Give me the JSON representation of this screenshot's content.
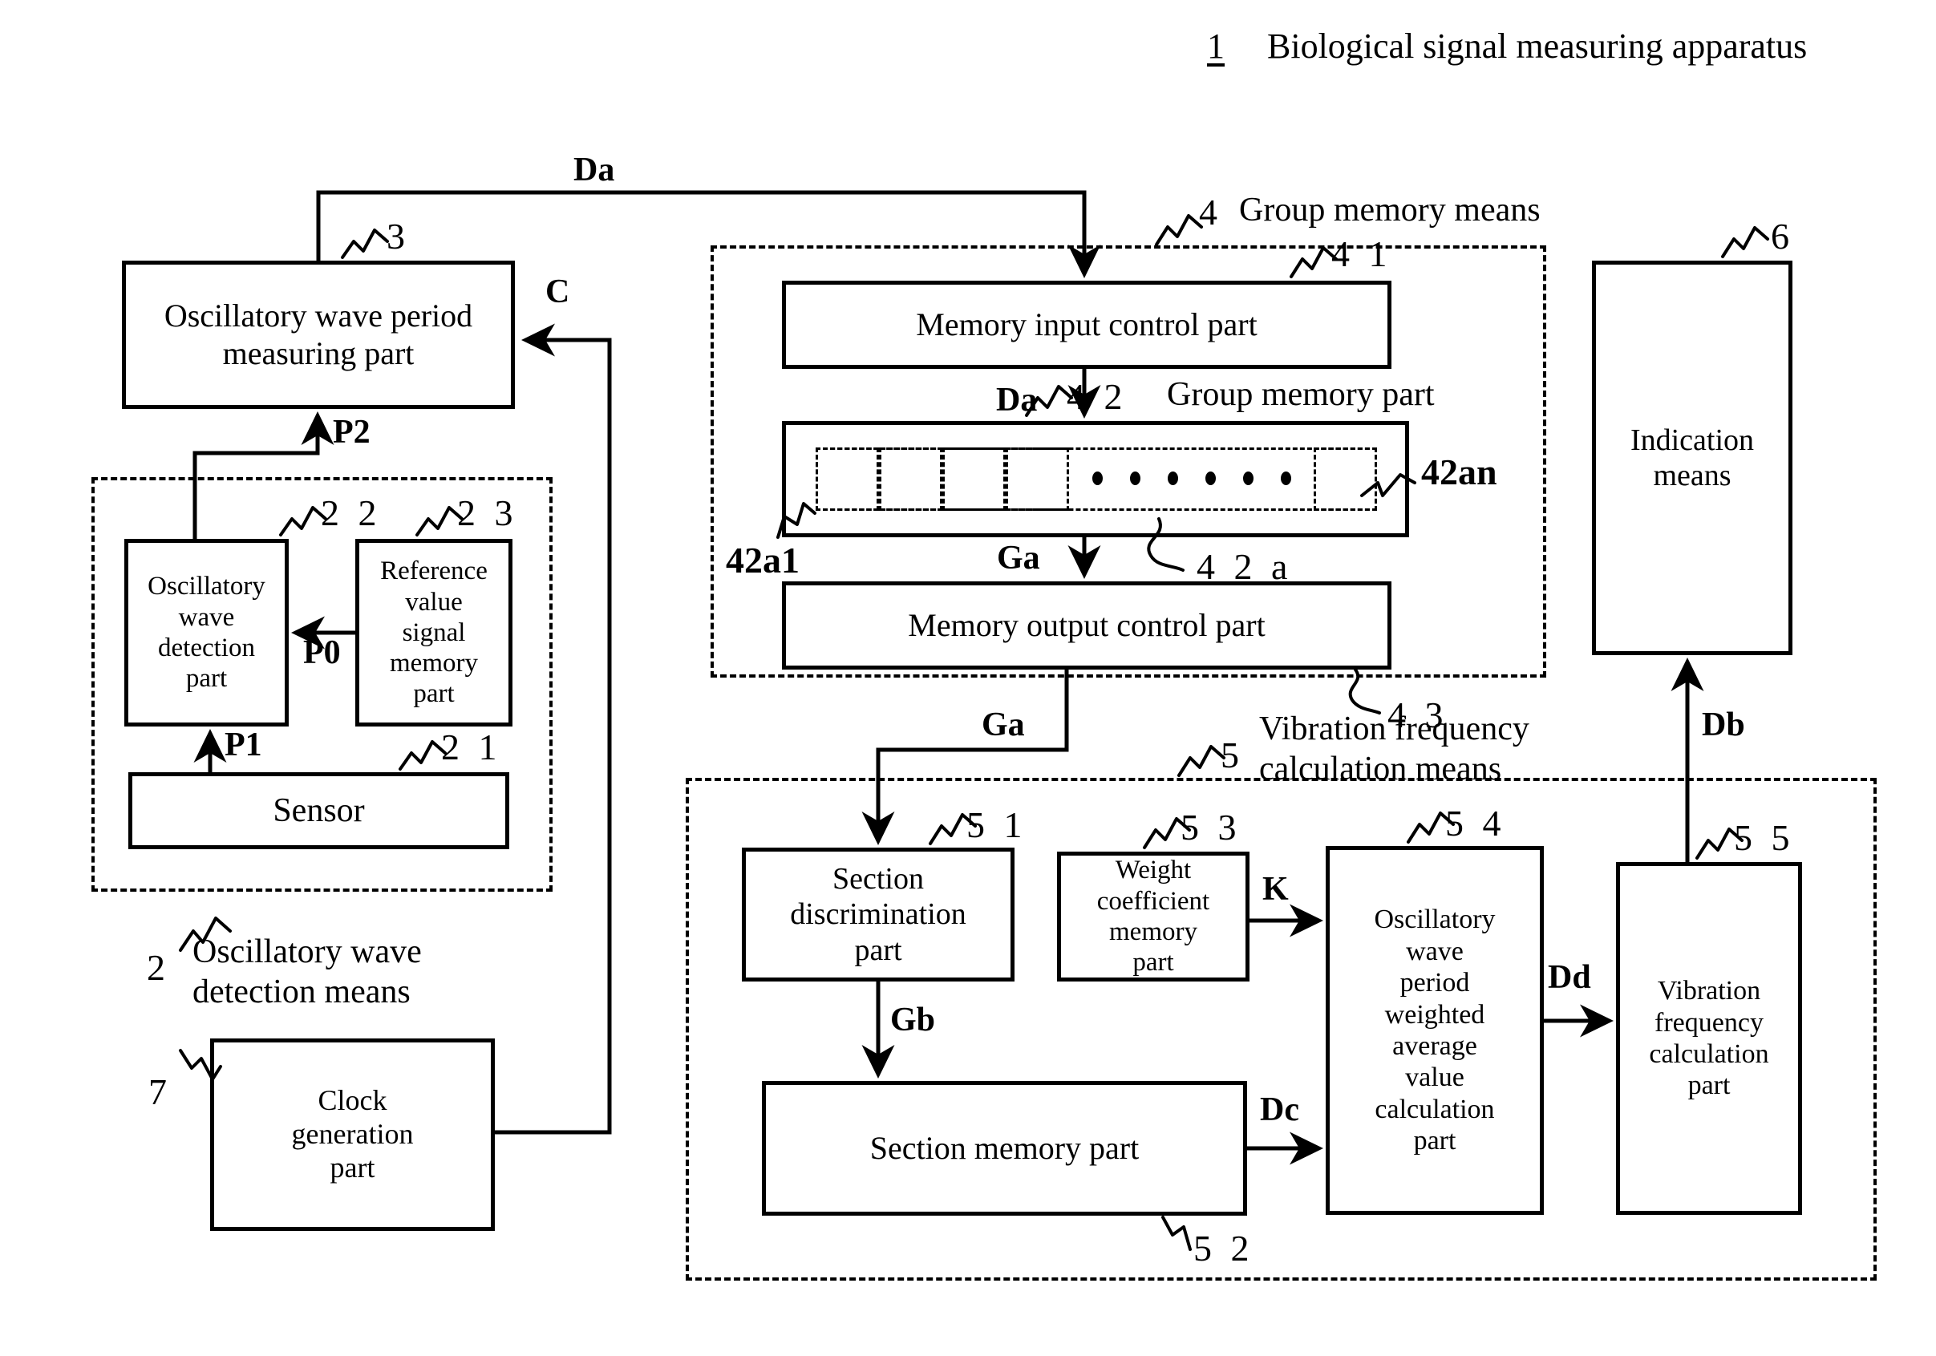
{
  "figure": {
    "title_number": "1",
    "title_text": "Biological signal measuring apparatus"
  },
  "blocks": {
    "osc_wave_period": {
      "ref": "3",
      "label": "Oscillatory wave period\nmeasuring part"
    },
    "osc_wave_detection": {
      "ref": "2 2",
      "label": "Oscillatory\nwave\ndetection\npart"
    },
    "reference_value_memory": {
      "ref": "2 3",
      "label": "Reference\nvalue\nsignal\nmemory\npart"
    },
    "sensor": {
      "ref": "2 1",
      "label": "Sensor"
    },
    "clock_generation": {
      "ref": "7",
      "label": "Clock\ngeneration\npart"
    },
    "memory_input_control": {
      "ref": "4 1",
      "label": "Memory input control part"
    },
    "group_memory_part": {
      "ref": "4 2",
      "ref_text": "Group memory part",
      "cell_first": "42a1",
      "cell_last": "42an",
      "cell_group": "4 2 a"
    },
    "memory_output_control": {
      "ref": "4 3",
      "label": "Memory output control part"
    },
    "indication_means": {
      "ref": "6",
      "label": "Indication\nmeans"
    },
    "section_discrimination": {
      "ref": "5 1",
      "label": "Section\ndiscrimination\npart"
    },
    "section_memory": {
      "ref": "5 2",
      "label": "Section memory part"
    },
    "weight_coefficient_memory": {
      "ref": "5 3",
      "label": "Weight\ncoefficient\nmemory\npart"
    },
    "osc_weighted_average": {
      "ref": "5 4",
      "label": "Oscillatory\nwave\nperiod\nweighted\naverage\nvalue\ncalculation\npart"
    },
    "vibration_frequency_calc": {
      "ref": "5 5",
      "label": "Vibration\nfrequency\ncalculation\npart"
    }
  },
  "groups": {
    "osc_detection_means": {
      "ref": "2",
      "label": "Oscillatory wave\ndetection means"
    },
    "group_memory_means": {
      "ref": "4",
      "label": "Group memory means"
    },
    "vibration_calc_means": {
      "ref": "5",
      "label": "Vibration frequency\ncalculation means"
    }
  },
  "signals": {
    "Da_top": "Da",
    "Da_mid": "Da",
    "Ga_mid": "Ga",
    "Ga_out": "Ga",
    "Gb": "Gb",
    "Dc": "Dc",
    "Dd": "Dd",
    "Db": "Db",
    "K": "K",
    "C": "C",
    "P0": "P0",
    "P1": "P1",
    "P2": "P2"
  }
}
